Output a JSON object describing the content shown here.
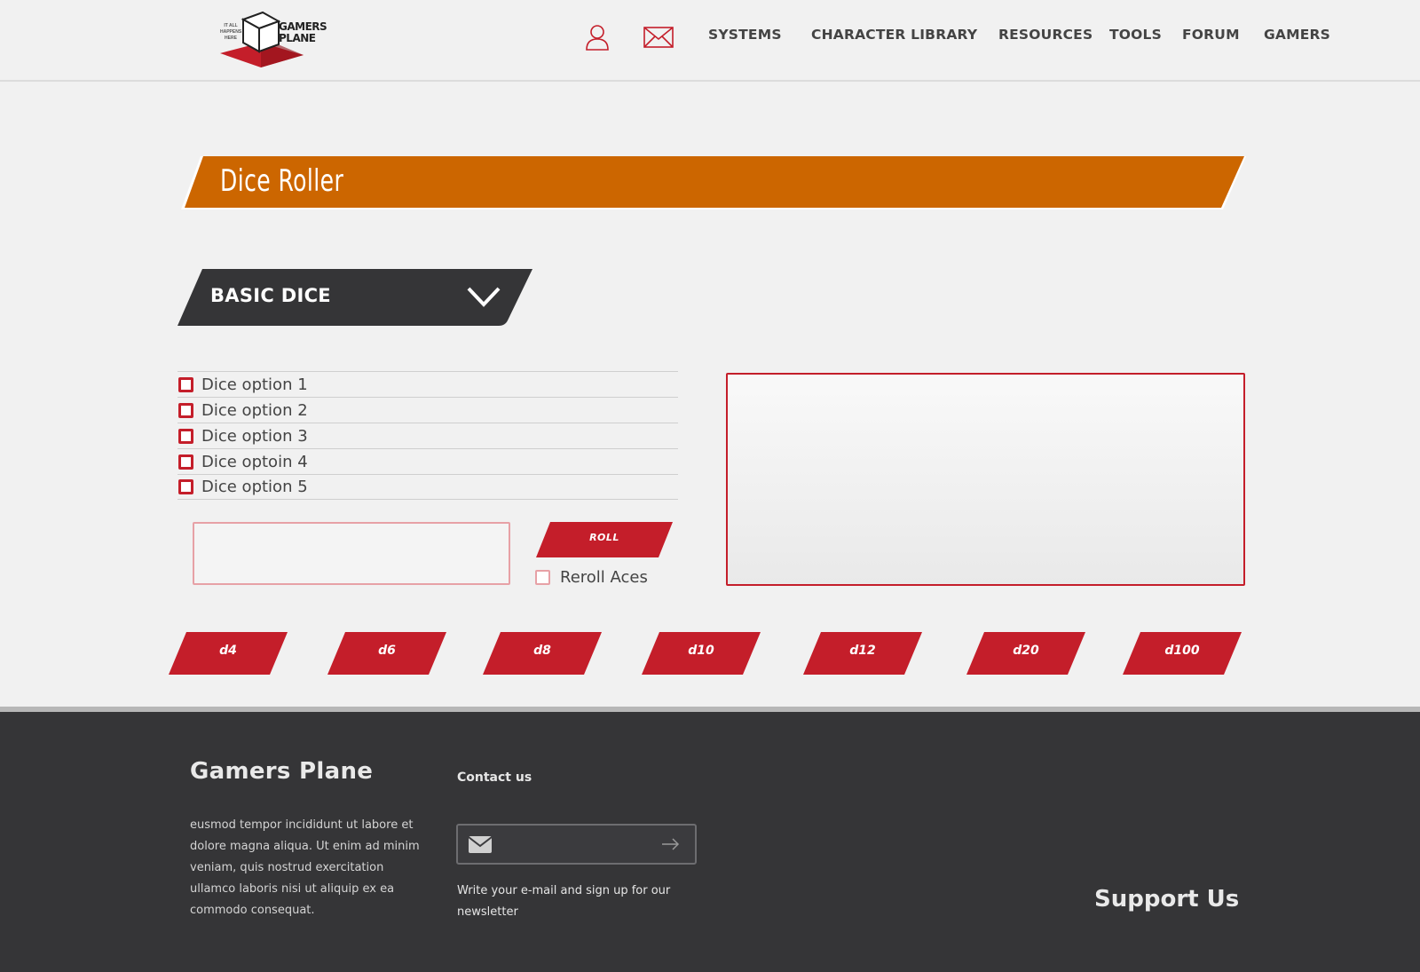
{
  "header": {
    "logo": {
      "tagline": "IT ALL HAPPENS HERE",
      "name_line1": "GAMERS",
      "name_line2": "PLANE"
    },
    "icons": {
      "user": "user-icon",
      "mail": "mail-icon"
    },
    "nav": [
      "SYSTEMS",
      "CHARACTER LIBRARY",
      "RESOURCES",
      "TOOLS",
      "FORUM",
      "GAMERS"
    ]
  },
  "page": {
    "title": "Dice Roller"
  },
  "basic_dice": {
    "label": "BASIC DICE",
    "options": [
      "Dice option 1",
      "Dice option 2",
      "Dice option 3",
      "Dice optoin 4",
      "Dice option 5"
    ],
    "roll_label": "ROLL",
    "reroll_label": "Reroll Aces",
    "dice": [
      "d4",
      "d6",
      "d8",
      "d10",
      "d12",
      "d20",
      "d100"
    ]
  },
  "footer": {
    "title": "Gamers Plane",
    "text": "eusmod tempor incididunt ut labore et dolore magna aliqua. Ut enim ad minim veniam, quis nostrud exercitation ullamco laboris nisi ut aliquip ex ea commodo consequat.",
    "contact": "Contact us",
    "newsletter": "Write your e-mail and sign up for our newsletter",
    "support": "Support Us"
  },
  "colors": {
    "accent_red": "#c41e2a",
    "banner_orange": "#cc6600",
    "dark": "#353537",
    "background": "#f1f1f1"
  }
}
